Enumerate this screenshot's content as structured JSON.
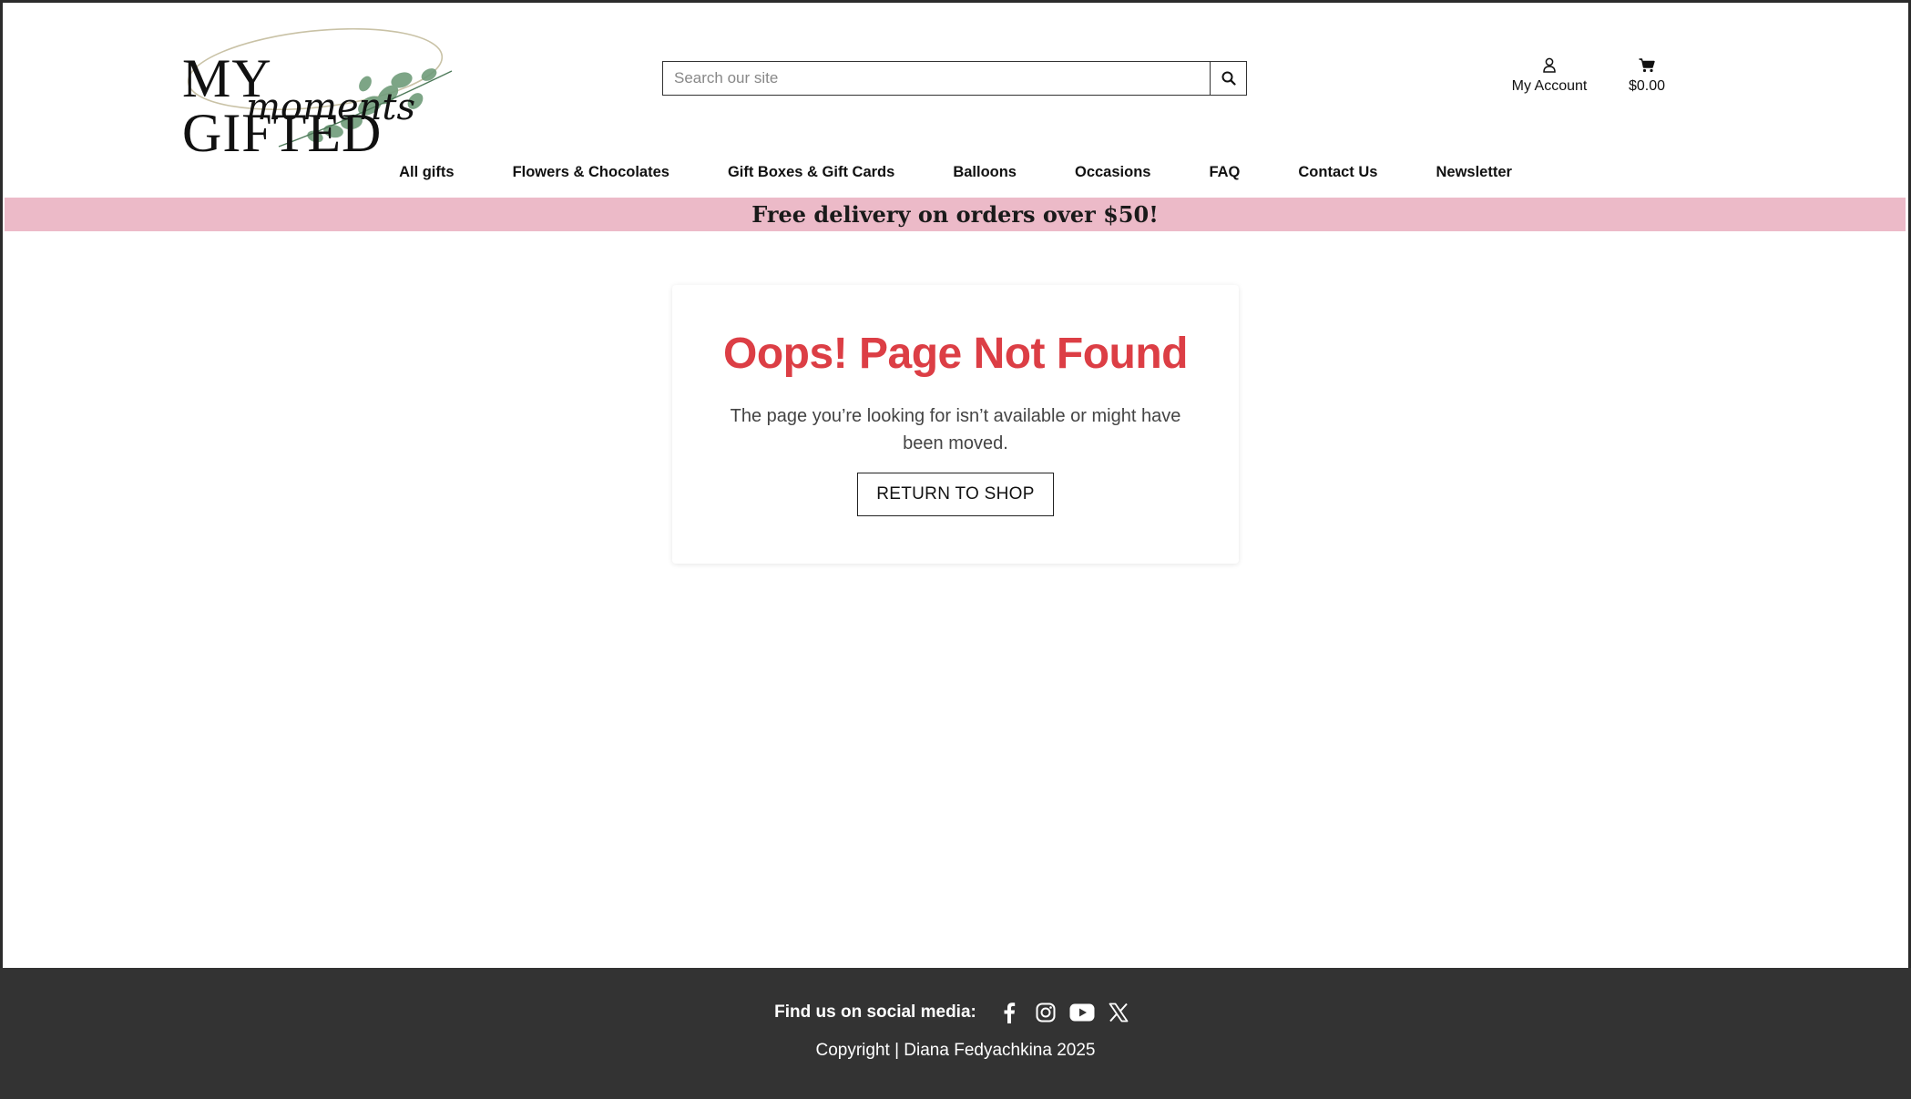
{
  "brand": {
    "logo_text_main": "MY GIFTED",
    "logo_text_script": "moments"
  },
  "search": {
    "placeholder": "Search our site",
    "value": ""
  },
  "account": {
    "label": "My Account"
  },
  "cart": {
    "total": "$0.00"
  },
  "nav": {
    "items": [
      {
        "label": "All gifts"
      },
      {
        "label": "Flowers & Chocolates"
      },
      {
        "label": "Gift Boxes & Gift Cards"
      },
      {
        "label": "Balloons"
      },
      {
        "label": "Occasions"
      },
      {
        "label": "FAQ"
      },
      {
        "label": "Contact Us"
      },
      {
        "label": "Newsletter"
      }
    ]
  },
  "promo": {
    "text": "Free delivery on orders over $50!"
  },
  "error": {
    "title": "Oops! Page Not Found",
    "message": "The page you’re looking for isn’t available or might have been moved.",
    "button_label": "RETURN TO SHOP"
  },
  "footer": {
    "social_label": "Find us on social media:",
    "social_icons": [
      "facebook-icon",
      "instagram-icon",
      "youtube-icon",
      "x-icon"
    ],
    "copyright": "Copyright | Diana Fedyachkina 2025"
  },
  "colors": {
    "accent_red": "#dc3e45",
    "promo_pink": "#ecbac8",
    "footer_bg": "#333333"
  }
}
